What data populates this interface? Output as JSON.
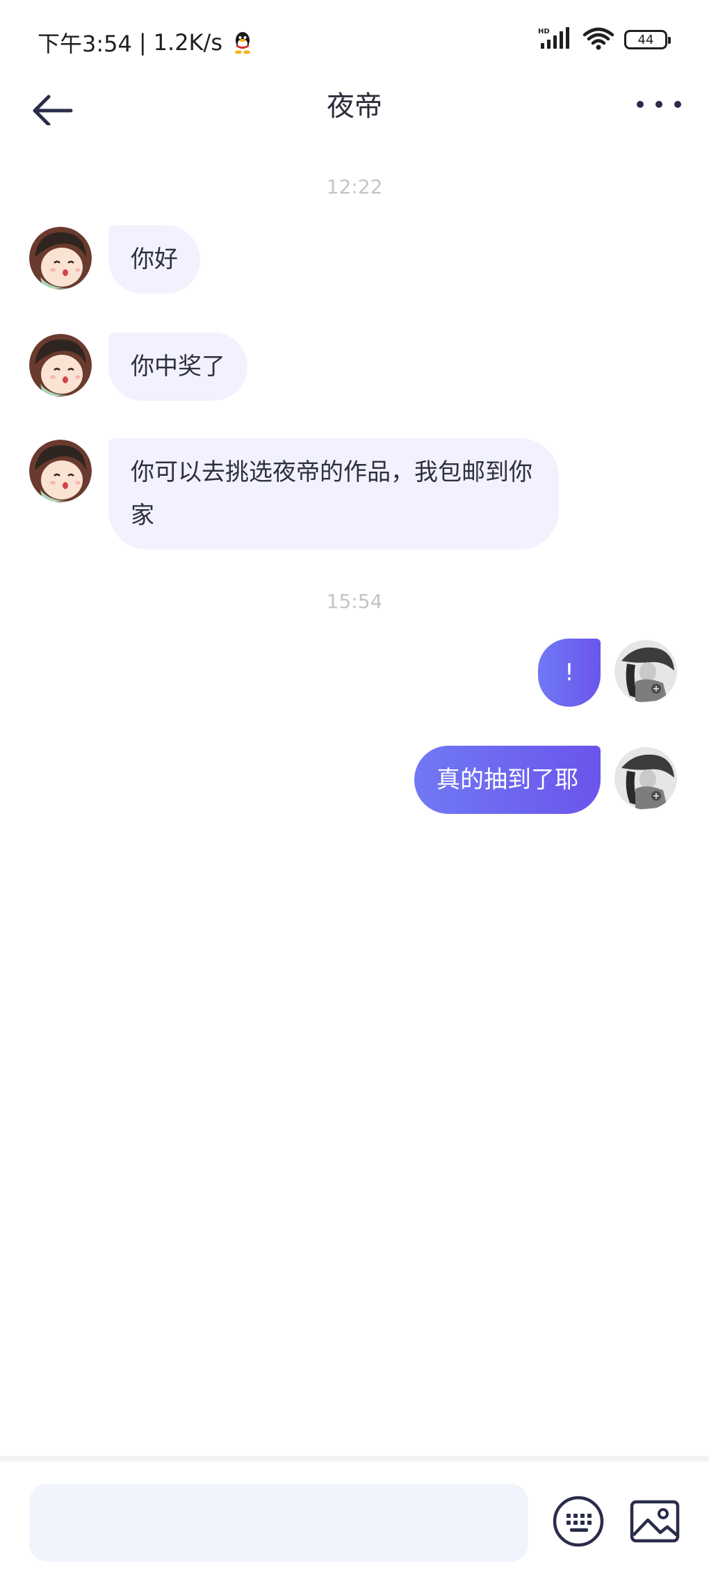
{
  "status_bar": {
    "time": "下午3:54",
    "separator": "|",
    "network_speed": "1.2K/s",
    "qq_icon": "qq-penguin-icon",
    "signal_label": "HD",
    "battery": "44"
  },
  "header": {
    "title": "夜帝",
    "back_icon": "arrow-left-icon",
    "more_icon": "more-dots-icon"
  },
  "messages": {
    "timestamp_1": "12:22",
    "incoming": [
      {
        "text": "你好"
      },
      {
        "text": "你中奖了"
      },
      {
        "text": "你可以去挑选夜帝的作品，我包邮到你家"
      }
    ],
    "timestamp_2": "15:54",
    "outgoing": [
      {
        "text": "!"
      },
      {
        "text": "真的抽到了耶"
      }
    ]
  },
  "input_bar": {
    "placeholder": "",
    "keyboard_icon": "keyboard-icon",
    "image_icon": "image-icon"
  },
  "colors": {
    "incoming_bubble": "#f2f1fe",
    "outgoing_bubble_start": "#7079f4",
    "outgoing_bubble_end": "#6a55ec",
    "icon_dark": "#2a2c4a",
    "timestamp": "#c4c4c8"
  }
}
